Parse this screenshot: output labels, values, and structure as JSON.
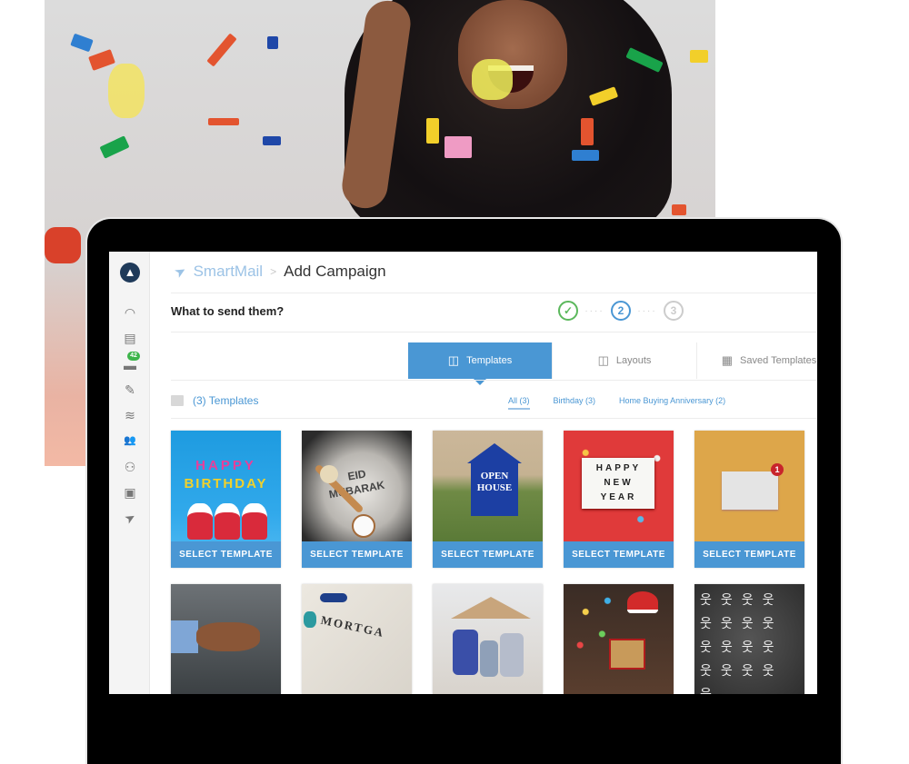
{
  "app": {
    "name": "SmartMail",
    "breadcrumb_separator": ">",
    "page_title": "Add Campaign"
  },
  "sidebar": {
    "items": [
      {
        "name": "dashboard",
        "icon": "gauge-icon",
        "glyph": "◠"
      },
      {
        "name": "listings",
        "icon": "card-icon",
        "glyph": "▤"
      },
      {
        "name": "messages",
        "icon": "chat-icon",
        "glyph": "▬",
        "badge": "42"
      },
      {
        "name": "campaigns",
        "icon": "edit-card-icon",
        "glyph": "✎"
      },
      {
        "name": "pipeline",
        "icon": "stack-icon",
        "glyph": "≋"
      },
      {
        "name": "contacts",
        "icon": "users-icon",
        "glyph": "👥"
      },
      {
        "name": "integrations",
        "icon": "network-icon",
        "glyph": "⚇"
      },
      {
        "name": "feedback",
        "icon": "feedback-icon",
        "glyph": "▣"
      },
      {
        "name": "smartmail",
        "icon": "send-icon",
        "glyph": "➤"
      }
    ]
  },
  "wizard": {
    "question": "What to send them?",
    "steps": [
      {
        "label": "✓",
        "state": "done"
      },
      {
        "label": "2",
        "state": "active"
      },
      {
        "label": "3",
        "state": "pending"
      }
    ]
  },
  "tabs": [
    {
      "label": "Templates",
      "active": true
    },
    {
      "label": "Layouts",
      "active": false
    },
    {
      "label": "Saved Templates",
      "active": false
    }
  ],
  "template_count": "(3) Templates",
  "filters": [
    {
      "label": "All (3)",
      "active": true
    },
    {
      "label": "Birthday (3)",
      "active": false
    },
    {
      "label": "Home Buying Anniversary (2)",
      "active": false
    }
  ],
  "templates": [
    {
      "name": "Happy Birthday",
      "caption": "HAPPY BIRTHDAY",
      "button": "SELECT TEMPLATE"
    },
    {
      "name": "Eid Mubarak",
      "caption": "EID MUBARAK",
      "button": "SELECT TEMPLATE"
    },
    {
      "name": "Open House",
      "caption": "OPEN HOUSE",
      "button": "SELECT TEMPLATE"
    },
    {
      "name": "Happy New Year",
      "caption": "HAPPY NEW YEAR",
      "button": "SELECT TEMPLATE"
    },
    {
      "name": "New Mail",
      "caption": "1",
      "button": "SELECT TEMPLATE"
    },
    {
      "name": "Handshake",
      "caption": ""
    },
    {
      "name": "Mortgage",
      "caption": "MORTGA"
    },
    {
      "name": "Family Home",
      "caption": ""
    },
    {
      "name": "Christmas Gift",
      "caption": ""
    },
    {
      "name": "Network",
      "caption": ""
    }
  ],
  "colors": {
    "accent": "#4a97d4",
    "success": "#5bb85c",
    "badge": "#3cb44a"
  }
}
